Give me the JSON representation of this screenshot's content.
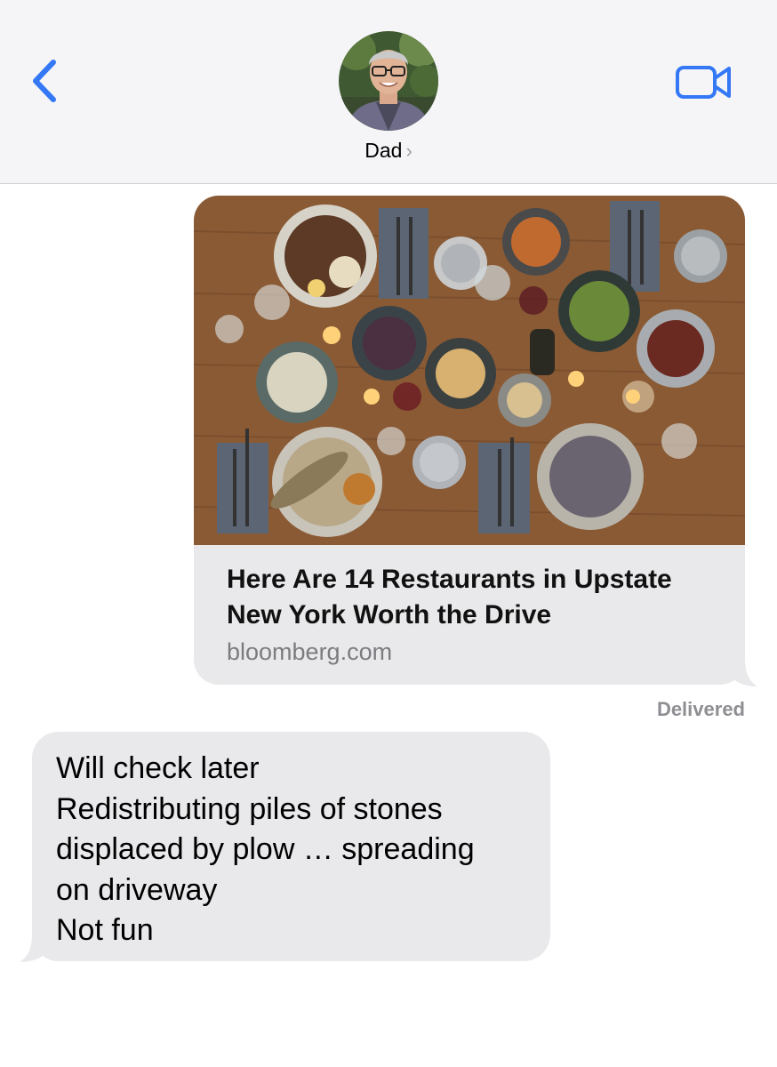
{
  "header": {
    "contact_name": "Dad",
    "chevron": "›",
    "back_icon": "chevron-left-icon",
    "video_icon": "video-camera-icon",
    "accent_color": "#3478f6"
  },
  "link_preview": {
    "title": "Here Are 14 Restaurants in Upstate New York Worth the Drive",
    "domain": "bloomberg.com"
  },
  "status": {
    "delivered": "Delivered"
  },
  "incoming_message": {
    "lines": [
      "Will check later",
      "Redistributing piles of stones",
      "displaced by plow … spreading",
      "on driveway",
      "Not fun"
    ]
  },
  "colors": {
    "bubble_gray": "#e9e9eb",
    "header_bg": "#f5f5f7",
    "meta_gray": "#8e8e93"
  }
}
